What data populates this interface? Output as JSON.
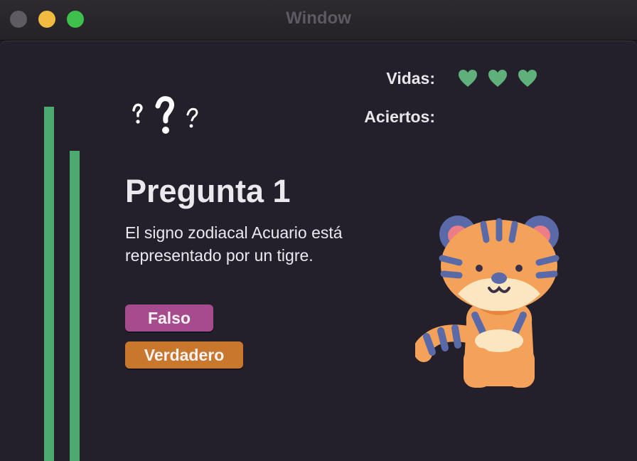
{
  "window": {
    "title": "Window",
    "controls": [
      "close-icon",
      "minimize-icon",
      "maximize-icon"
    ]
  },
  "stats": {
    "lives_label": "Vidas:",
    "lives_count": 3,
    "hits_label": "Aciertos:"
  },
  "question": {
    "title": "Pregunta 1",
    "text": "El signo zodiacal Acuario está representado por un tigre."
  },
  "answers": {
    "false_label": "Falso",
    "true_label": "Verdadero"
  },
  "icons": {
    "decoration": "question-marks-icon",
    "life": "heart-icon",
    "illustration": "tiger-icon"
  },
  "colors": {
    "progress_bar": "#4daa6e",
    "heart": "#5fb07a",
    "false_button": "#a64b8d",
    "true_button": "#c8772d",
    "background": "#231f2b"
  }
}
